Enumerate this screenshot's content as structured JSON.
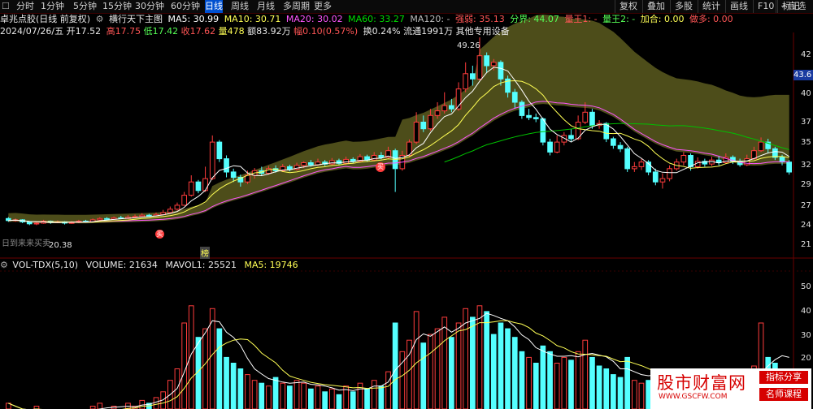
{
  "toolbar": {
    "items": [
      "分时",
      "1分钟",
      "5分钟",
      "15分钟",
      "30分钟",
      "60分钟",
      "日线",
      "周线",
      "月线",
      "多周期",
      "更多"
    ],
    "active": "日线",
    "right": [
      "复权",
      "叠加",
      "多股",
      "统计",
      "画线",
      "F10",
      "标记",
      "+自选"
    ]
  },
  "info": {
    "stock": "卓兆点胶(日线 前复权)",
    "indicator": "横行天下主图",
    "ma5": "MA5: 30.99",
    "ma10": "MA10: 30.71",
    "ma20": "MA20: 30.02",
    "ma60": "MA60: 33.27",
    "ma120": "MA120: -",
    "weak": "强弱: 35.13",
    "bound": "分界: 44.07",
    "lk1": "量王1: -",
    "lk2": "量王2: -",
    "add": "加合: 0.00",
    "sell": "做多: 0.00",
    "date": "2024/07/26/五",
    "open": "开17.52",
    "high": "高17.75",
    "low": "低17.42",
    "close": "收17.62",
    "vol": "量478",
    "amt": "额83.92万",
    "chg": "幅0.10(0.57%)",
    "turn": "换0.24%",
    "float": "流通1991万",
    "other": "其他专用设备"
  },
  "price_axis": [
    "42",
    "40",
    "37",
    "35",
    "32",
    "29",
    "27",
    "24",
    "21"
  ],
  "last_price": "43.6",
  "annotations": {
    "peak": "49.26",
    "low": "20.38",
    "bottom_note": "日到来来买卖",
    "mark": "榜"
  },
  "volume": {
    "title": "VOL-TDX(5,10)",
    "volume": "VOLUME: 21634",
    "mavol1": "MAVOL1: 25521",
    "ma5": "MA5: 19746",
    "axis": [
      "50",
      "40",
      "30",
      "20"
    ]
  },
  "watermark": {
    "text": "股市财富网",
    "url": "WWW.GSCFW.COM",
    "tag1": "指标分享",
    "tag2": "名师课程"
  },
  "colors": {
    "up": "#ff3c3c",
    "down": "#54ffff",
    "ma5": "#ffffff",
    "ma10": "#ffff55",
    "ma20": "#ff55ff",
    "band": "#5a5a1e",
    "ma60": "#00c000"
  },
  "chart_data": {
    "type": "candlestick",
    "candles": [
      [
        22.0,
        21.7,
        22.2,
        21.5
      ],
      [
        21.7,
        21.8,
        22.0,
        21.5
      ],
      [
        21.8,
        21.5,
        21.9,
        21.3
      ],
      [
        21.5,
        21.2,
        21.6,
        21.0
      ],
      [
        21.2,
        21.3,
        21.5,
        21.0
      ],
      [
        21.3,
        21.6,
        21.8,
        21.2
      ],
      [
        21.6,
        21.4,
        21.7,
        21.2
      ],
      [
        21.4,
        21.5,
        21.7,
        21.3
      ],
      [
        21.5,
        21.3,
        21.6,
        21.1
      ],
      [
        21.3,
        21.4,
        21.6,
        21.2
      ],
      [
        21.4,
        21.6,
        21.8,
        21.3
      ],
      [
        21.6,
        21.5,
        21.8,
        21.4
      ],
      [
        21.5,
        21.8,
        22.0,
        21.4
      ],
      [
        21.8,
        22.0,
        22.2,
        21.7
      ],
      [
        22.0,
        21.9,
        22.2,
        21.8
      ],
      [
        21.9,
        22.1,
        22.3,
        21.8
      ],
      [
        22.1,
        22.0,
        22.4,
        21.9
      ],
      [
        22.0,
        22.2,
        22.5,
        21.9
      ],
      [
        22.2,
        22.3,
        22.6,
        22.1
      ],
      [
        22.3,
        22.5,
        22.8,
        22.2
      ],
      [
        22.5,
        22.4,
        22.7,
        22.3
      ],
      [
        22.4,
        22.6,
        22.9,
        22.3
      ],
      [
        22.6,
        22.9,
        23.3,
        22.5
      ],
      [
        22.9,
        23.4,
        23.8,
        22.8
      ],
      [
        23.4,
        24.0,
        24.4,
        23.2
      ],
      [
        24.0,
        25.5,
        26.0,
        23.9
      ],
      [
        25.5,
        27.5,
        28.5,
        25.3
      ],
      [
        27.5,
        26.2,
        27.8,
        25.8
      ],
      [
        26.2,
        28.0,
        29.8,
        26.0
      ],
      [
        28.0,
        33.5,
        34.5,
        27.8
      ],
      [
        33.5,
        31.0,
        33.8,
        30.5
      ],
      [
        31.0,
        29.0,
        31.5,
        28.2
      ],
      [
        29.0,
        28.2,
        29.5,
        27.5
      ],
      [
        28.2,
        27.5,
        28.6,
        26.8
      ],
      [
        27.5,
        28.5,
        29.2,
        27.2
      ],
      [
        28.5,
        29.2,
        29.6,
        28.0
      ],
      [
        29.2,
        28.8,
        29.8,
        28.5
      ],
      [
        28.8,
        29.5,
        29.9,
        28.6
      ],
      [
        29.5,
        29.2,
        30.0,
        28.9
      ],
      [
        29.2,
        29.8,
        30.2,
        29.0
      ],
      [
        29.8,
        29.4,
        30.1,
        29.1
      ],
      [
        29.4,
        30.0,
        30.4,
        29.2
      ],
      [
        30.0,
        30.4,
        30.6,
        29.6
      ],
      [
        30.4,
        30.1,
        30.8,
        29.8
      ],
      [
        30.1,
        30.5,
        31.0,
        29.9
      ],
      [
        30.5,
        30.2,
        30.8,
        29.9
      ],
      [
        30.2,
        30.7,
        31.1,
        30.0
      ],
      [
        30.7,
        30.3,
        31.0,
        30.0
      ],
      [
        30.3,
        30.9,
        31.3,
        30.1
      ],
      [
        30.9,
        30.6,
        31.2,
        30.3
      ],
      [
        30.6,
        31.3,
        31.7,
        30.4
      ],
      [
        31.3,
        30.8,
        31.6,
        30.5
      ],
      [
        30.8,
        31.5,
        32.0,
        30.6
      ],
      [
        31.5,
        31.2,
        32.0,
        30.9
      ],
      [
        31.2,
        32.2,
        32.8,
        31.0
      ],
      [
        32.2,
        29.5,
        32.5,
        26.0
      ],
      [
        29.5,
        31.5,
        32.2,
        29.2
      ],
      [
        31.5,
        33.5,
        33.9,
        31.2
      ],
      [
        33.5,
        36.5,
        38.0,
        33.2
      ],
      [
        36.5,
        35.5,
        37.5,
        35.0
      ],
      [
        35.5,
        37.5,
        38.5,
        35.2
      ],
      [
        37.5,
        38.2,
        39.5,
        37.0
      ],
      [
        38.2,
        39.0,
        41.0,
        37.8
      ],
      [
        39.0,
        38.5,
        40.0,
        38.0
      ],
      [
        38.5,
        41.5,
        42.5,
        38.2
      ],
      [
        41.5,
        43.8,
        45.5,
        41.0
      ],
      [
        43.8,
        43.0,
        45.0,
        42.0
      ],
      [
        43.0,
        46.5,
        49.26,
        42.8
      ],
      [
        46.5,
        45.0,
        47.0,
        44.0
      ],
      [
        45.0,
        45.5,
        46.0,
        44.3
      ],
      [
        45.5,
        43.0,
        45.8,
        42.0
      ],
      [
        43.0,
        41.0,
        43.5,
        40.2
      ],
      [
        41.0,
        39.5,
        41.5,
        38.5
      ],
      [
        39.5,
        37.5,
        39.8,
        37.0
      ],
      [
        37.5,
        37.2,
        38.5,
        36.8
      ],
      [
        37.2,
        37.0,
        37.8,
        36.5
      ],
      [
        37.0,
        33.5,
        37.2,
        33.0
      ],
      [
        33.5,
        32.0,
        34.0,
        31.5
      ],
      [
        32.0,
        33.5,
        34.5,
        31.8
      ],
      [
        33.5,
        34.5,
        35.0,
        33.0
      ],
      [
        34.5,
        34.0,
        35.5,
        33.6
      ],
      [
        34.0,
        36.5,
        37.5,
        33.8
      ],
      [
        36.5,
        38.0,
        39.5,
        36.2
      ],
      [
        38.0,
        36.0,
        38.5,
        35.5
      ],
      [
        36.0,
        36.3,
        36.8,
        35.5
      ],
      [
        36.3,
        34.0,
        36.5,
        33.5
      ],
      [
        34.0,
        33.0,
        34.3,
        32.5
      ],
      [
        33.0,
        32.5,
        33.5,
        32.0
      ],
      [
        32.5,
        29.5,
        32.8,
        29.0
      ],
      [
        29.5,
        29.8,
        30.5,
        29.0
      ],
      [
        29.8,
        30.5,
        31.0,
        29.3
      ],
      [
        30.5,
        29.0,
        30.8,
        28.5
      ],
      [
        29.0,
        27.5,
        29.5,
        27.0
      ],
      [
        27.5,
        28.0,
        28.8,
        26.5
      ],
      [
        28.0,
        29.5,
        30.0,
        27.6
      ],
      [
        29.5,
        30.5,
        31.0,
        29.2
      ],
      [
        30.5,
        31.5,
        32.0,
        30.0
      ],
      [
        31.5,
        29.8,
        31.8,
        29.2
      ],
      [
        29.8,
        30.6,
        31.2,
        29.5
      ],
      [
        30.6,
        30.2,
        31.0,
        29.8
      ],
      [
        30.2,
        30.8,
        31.3,
        29.9
      ],
      [
        30.8,
        30.4,
        31.4,
        30.0
      ],
      [
        30.4,
        31.2,
        31.8,
        30.2
      ],
      [
        31.2,
        30.6,
        31.5,
        30.2
      ],
      [
        30.6,
        30.1,
        31.0,
        29.8
      ],
      [
        30.1,
        31.0,
        31.6,
        29.9
      ],
      [
        31.0,
        32.2,
        32.8,
        30.8
      ],
      [
        32.2,
        33.5,
        34.2,
        32.0
      ],
      [
        33.5,
        32.5,
        34.0,
        31.8
      ],
      [
        32.5,
        31.2,
        32.8,
        30.8
      ],
      [
        31.2,
        30.5,
        31.6,
        30.0
      ],
      [
        30.5,
        29.0,
        30.8,
        28.6
      ]
    ],
    "volumes": [
      [
        12,
        0
      ],
      [
        10,
        1
      ],
      [
        8,
        1
      ],
      [
        9,
        1
      ],
      [
        11,
        0
      ],
      [
        9,
        0
      ],
      [
        10,
        1
      ],
      [
        8,
        0
      ],
      [
        9,
        1
      ],
      [
        8,
        0
      ],
      [
        10,
        0
      ],
      [
        9,
        1
      ],
      [
        11,
        0
      ],
      [
        12,
        0
      ],
      [
        10,
        1
      ],
      [
        11,
        0
      ],
      [
        10,
        1
      ],
      [
        12,
        0
      ],
      [
        11,
        0
      ],
      [
        13,
        0
      ],
      [
        12,
        1
      ],
      [
        14,
        0
      ],
      [
        16,
        0
      ],
      [
        20,
        0
      ],
      [
        24,
        0
      ],
      [
        40,
        0
      ],
      [
        46,
        0
      ],
      [
        35,
        1
      ],
      [
        38,
        0
      ],
      [
        45,
        0
      ],
      [
        38,
        1
      ],
      [
        28,
        1
      ],
      [
        26,
        1
      ],
      [
        24,
        1
      ],
      [
        22,
        0
      ],
      [
        20,
        0
      ],
      [
        19,
        1
      ],
      [
        18,
        0
      ],
      [
        21,
        1
      ],
      [
        19,
        0
      ],
      [
        18,
        1
      ],
      [
        20,
        0
      ],
      [
        19,
        0
      ],
      [
        17,
        1
      ],
      [
        18,
        0
      ],
      [
        16,
        1
      ],
      [
        17,
        0
      ],
      [
        15,
        1
      ],
      [
        18,
        0
      ],
      [
        16,
        1
      ],
      [
        19,
        0
      ],
      [
        17,
        1
      ],
      [
        20,
        0
      ],
      [
        18,
        1
      ],
      [
        23,
        0
      ],
      [
        40,
        1
      ],
      [
        30,
        0
      ],
      [
        34,
        0
      ],
      [
        44,
        0
      ],
      [
        33,
        1
      ],
      [
        36,
        0
      ],
      [
        38,
        0
      ],
      [
        42,
        0
      ],
      [
        35,
        1
      ],
      [
        40,
        0
      ],
      [
        45,
        0
      ],
      [
        42,
        1
      ],
      [
        46,
        0
      ],
      [
        44,
        1
      ],
      [
        36,
        1
      ],
      [
        40,
        1
      ],
      [
        38,
        1
      ],
      [
        35,
        1
      ],
      [
        30,
        1
      ],
      [
        28,
        0
      ],
      [
        26,
        1
      ],
      [
        32,
        1
      ],
      [
        30,
        1
      ],
      [
        26,
        0
      ],
      [
        28,
        0
      ],
      [
        27,
        1
      ],
      [
        30,
        0
      ],
      [
        34,
        0
      ],
      [
        28,
        1
      ],
      [
        25,
        1
      ],
      [
        24,
        1
      ],
      [
        22,
        1
      ],
      [
        21,
        1
      ],
      [
        28,
        1
      ],
      [
        20,
        0
      ],
      [
        19,
        0
      ],
      [
        20,
        1
      ],
      [
        22,
        1
      ],
      [
        21,
        0
      ],
      [
        20,
        0
      ],
      [
        18,
        0
      ],
      [
        17,
        0
      ],
      [
        20,
        1
      ],
      [
        18,
        0
      ],
      [
        17,
        1
      ],
      [
        16,
        0
      ],
      [
        17,
        1
      ],
      [
        18,
        0
      ],
      [
        16,
        1
      ],
      [
        15,
        1
      ],
      [
        17,
        0
      ],
      [
        25,
        0
      ],
      [
        40,
        0
      ],
      [
        28,
        1
      ],
      [
        26,
        1
      ],
      [
        24,
        1
      ],
      [
        22,
        1
      ]
    ],
    "ylim": [
      18,
      50
    ],
    "vol_ylim": [
      10,
      55
    ]
  }
}
